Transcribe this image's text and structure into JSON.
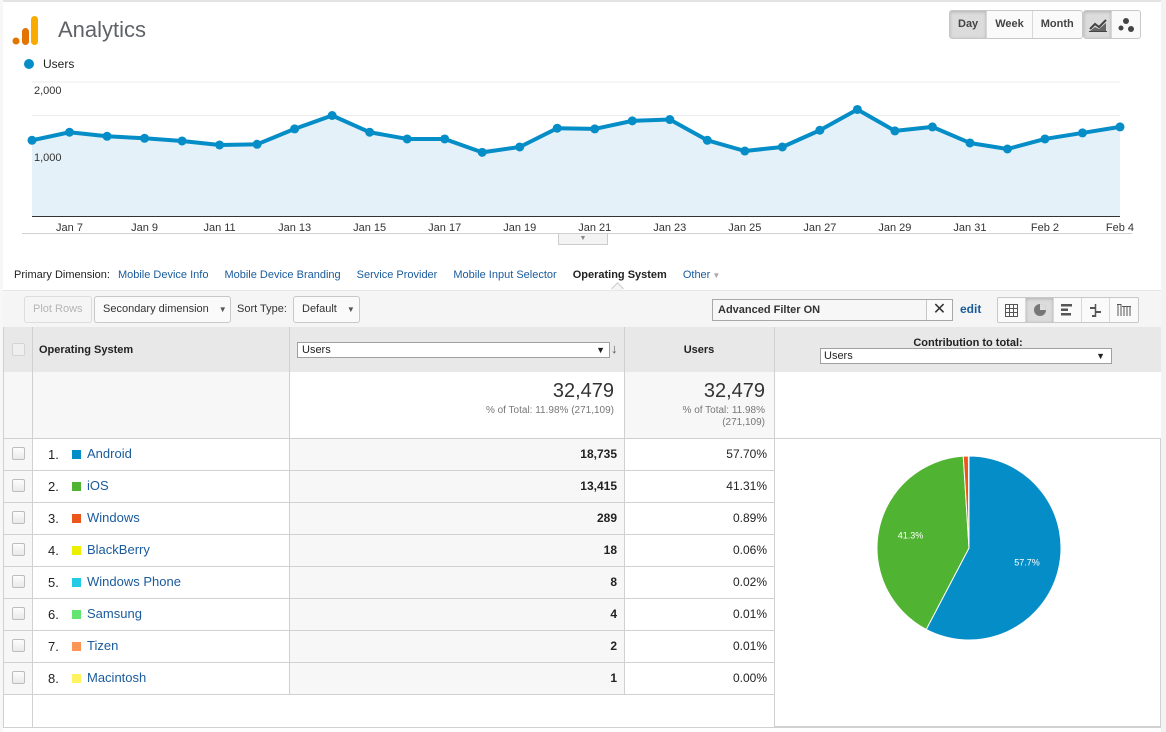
{
  "header": {
    "app_title": "Analytics",
    "granularity": [
      {
        "label": "Day",
        "active": true
      },
      {
        "label": "Week",
        "active": false
      },
      {
        "label": "Month",
        "active": false
      }
    ],
    "chart_type_buttons": [
      {
        "icon": "line-chart-icon",
        "active": true
      },
      {
        "icon": "motion-chart-icon",
        "active": false
      }
    ]
  },
  "chart_data": [
    {
      "type": "area",
      "title": "",
      "legend": [
        {
          "name": "Users",
          "color": "#058dc7"
        }
      ],
      "legend_position": "top-left",
      "x": [
        "Jan 6",
        "Jan 7",
        "Jan 8",
        "Jan 9",
        "Jan 10",
        "Jan 11",
        "Jan 12",
        "Jan 13",
        "Jan 14",
        "Jan 15",
        "Jan 16",
        "Jan 17",
        "Jan 18",
        "Jan 19",
        "Jan 20",
        "Jan 21",
        "Jan 22",
        "Jan 23",
        "Jan 24",
        "Jan 25",
        "Jan 26",
        "Jan 27",
        "Jan 28",
        "Jan 29",
        "Jan 30",
        "Jan 31",
        "Feb 1",
        "Feb 2",
        "Feb 3",
        "Feb 4"
      ],
      "x_tick_labels": [
        "Jan 7",
        "Jan 9",
        "Jan 11",
        "Jan 13",
        "Jan 15",
        "Jan 17",
        "Jan 19",
        "Jan 21",
        "Jan 23",
        "Jan 25",
        "Jan 27",
        "Jan 29",
        "Jan 31",
        "Feb 2",
        "Feb 4"
      ],
      "series": [
        {
          "name": "Users",
          "color": "#058dc7",
          "values": [
            1130,
            1250,
            1190,
            1160,
            1120,
            1060,
            1070,
            1300,
            1500,
            1250,
            1150,
            1150,
            950,
            1030,
            1310,
            1300,
            1420,
            1440,
            1130,
            970,
            1030,
            1280,
            1590,
            1270,
            1330,
            1090,
            1000,
            1150,
            1240,
            1330
          ]
        }
      ],
      "y_tick_labels": [
        "1,000",
        "2,000"
      ],
      "y_ticks": [
        1000,
        2000
      ],
      "ylim": [
        0,
        2000
      ],
      "grid": true,
      "xlabel": "",
      "ylabel": ""
    },
    {
      "type": "pie",
      "title": "Contribution to total: Users",
      "slices": [
        {
          "name": "Android",
          "value": 57.7,
          "label": "57.7%",
          "color": "#058dc7"
        },
        {
          "name": "iOS",
          "value": 41.31,
          "label": "41.3%",
          "color": "#50b432"
        },
        {
          "name": "Windows",
          "value": 0.89,
          "label": "",
          "color": "#ed561b"
        },
        {
          "name": "BlackBerry",
          "value": 0.06,
          "label": "",
          "color": "#edef00"
        },
        {
          "name": "Windows Phone",
          "value": 0.02,
          "label": "",
          "color": "#24cbe5"
        },
        {
          "name": "Samsung",
          "value": 0.01,
          "label": "",
          "color": "#64e572"
        },
        {
          "name": "Tizen",
          "value": 0.01,
          "label": "",
          "color": "#ff9655"
        },
        {
          "name": "Macintosh",
          "value": 0.0,
          "label": "",
          "color": "#fff263"
        }
      ]
    }
  ],
  "primary_dimension": {
    "label": "Primary Dimension:",
    "options": [
      {
        "label": "Mobile Device Info",
        "active": false
      },
      {
        "label": "Mobile Device Branding",
        "active": false
      },
      {
        "label": "Service Provider",
        "active": false
      },
      {
        "label": "Mobile Input Selector",
        "active": false
      },
      {
        "label": "Operating System",
        "active": true
      },
      {
        "label": "Other",
        "active": false
      }
    ]
  },
  "toolbar": {
    "plot_rows": "Plot Rows",
    "secondary_dimension": "Secondary dimension",
    "sort_type_label": "Sort Type:",
    "sort_type_value": "Default",
    "filter_text": "Advanced Filter ON",
    "filter_clear": "✕",
    "edit": "edit",
    "view_icons": [
      "table-view-icon",
      "pie-view-icon",
      "performance-view-icon",
      "comparison-view-icon",
      "pivot-view-icon"
    ],
    "active_view": "pie-view-icon"
  },
  "table": {
    "dimension_header": "Operating System",
    "metric_select": "Users",
    "metric_header": "Users",
    "contribution_header": "Contribution to total:",
    "contribution_select": "Users",
    "totals": {
      "value": "32,479",
      "value_sub": "% of Total: 11.98% (271,109)",
      "pct_value": "32,479",
      "pct_sub_1": "% of Total: 11.98%",
      "pct_sub_2": "(271,109)"
    },
    "rows": [
      {
        "rank": "1.",
        "name": "Android",
        "color": "#058dc7",
        "users": "18,735",
        "pct": "57.70%"
      },
      {
        "rank": "2.",
        "name": "iOS",
        "color": "#50b432",
        "users": "13,415",
        "pct": "41.31%"
      },
      {
        "rank": "3.",
        "name": "Windows",
        "color": "#ed561b",
        "users": "289",
        "pct": "0.89%"
      },
      {
        "rank": "4.",
        "name": "BlackBerry",
        "color": "#edef00",
        "users": "18",
        "pct": "0.06%"
      },
      {
        "rank": "5.",
        "name": "Windows Phone",
        "color": "#24cbe5",
        "users": "8",
        "pct": "0.02%"
      },
      {
        "rank": "6.",
        "name": "Samsung",
        "color": "#64e572",
        "users": "4",
        "pct": "0.01%"
      },
      {
        "rank": "7.",
        "name": "Tizen",
        "color": "#ff9655",
        "users": "2",
        "pct": "0.01%"
      },
      {
        "rank": "8.",
        "name": "Macintosh",
        "color": "#fff263",
        "users": "1",
        "pct": "0.00%"
      }
    ]
  }
}
